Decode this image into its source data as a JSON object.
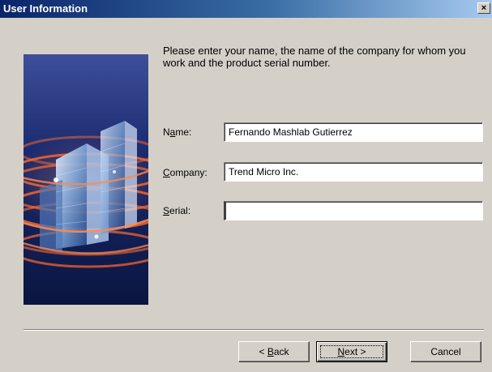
{
  "window": {
    "title": "User Information",
    "close_glyph": "×"
  },
  "intro_text": "Please enter your name, the name of the company for whom you work and the product serial number.",
  "form": {
    "name": {
      "label_pre": "N",
      "label_accel": "a",
      "label_post": "me:",
      "value": "Fernando Mashlab Gutierrez"
    },
    "company": {
      "label_pre": "",
      "label_accel": "C",
      "label_post": "ompany:",
      "value": "Trend Micro Inc."
    },
    "serial": {
      "label_pre": "",
      "label_accel": "S",
      "label_post": "erial:",
      "value": ""
    }
  },
  "buttons": {
    "back": {
      "pre": "< ",
      "accel": "B",
      "post": "ack"
    },
    "next": {
      "pre": "",
      "accel": "N",
      "post": "ext >"
    },
    "cancel": "Cancel"
  },
  "colors": {
    "title_bar_start": "#0a246a",
    "title_bar_end": "#a6caf0",
    "dialog_face": "#d4d0c8",
    "banner_bg": "#0f1f5c",
    "swirl": "#ff6a2b"
  },
  "icons": {
    "banner": "buildings-swirl-graphic",
    "close": "close-icon"
  }
}
